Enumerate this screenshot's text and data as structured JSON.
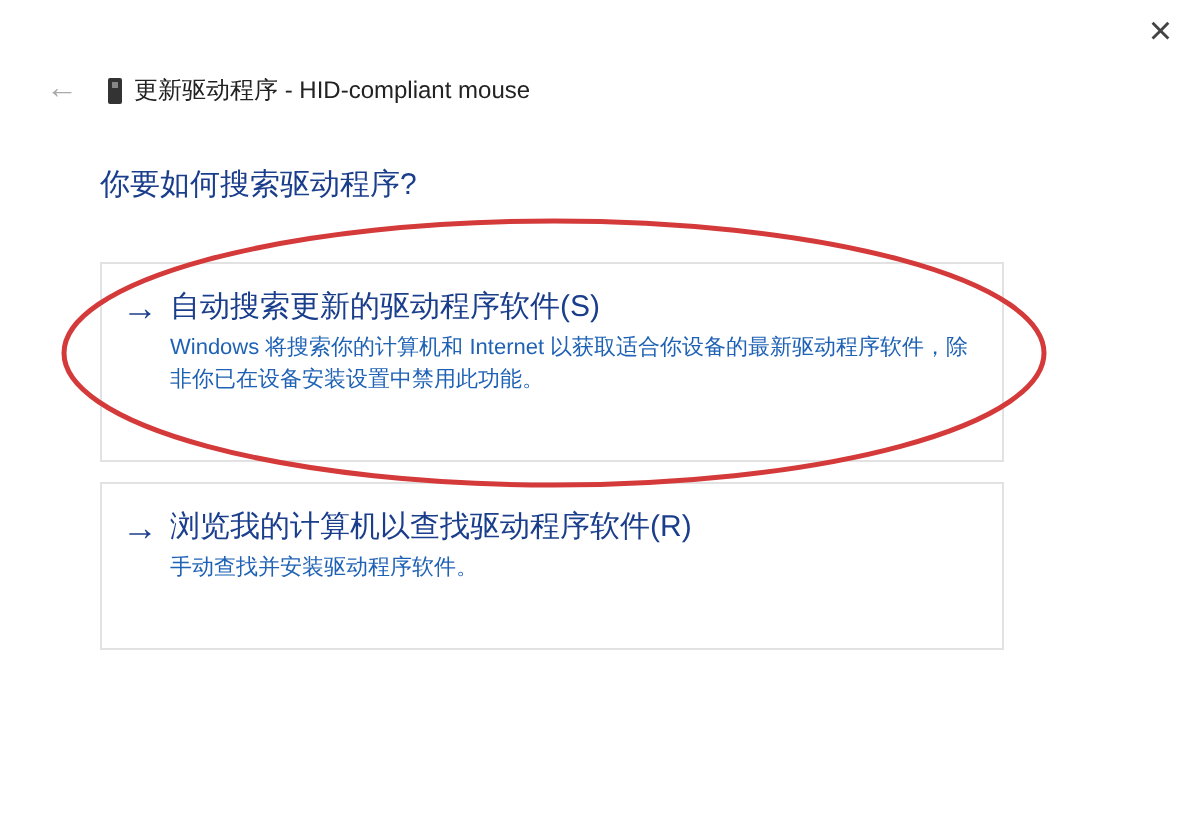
{
  "window": {
    "close": "×"
  },
  "header": {
    "back": "←",
    "title": "更新驱动程序 - HID-compliant mouse"
  },
  "question": "你要如何搜索驱动程序?",
  "options": [
    {
      "arrow": "→",
      "title": "自动搜索更新的驱动程序软件(S)",
      "description": "Windows 将搜索你的计算机和 Internet 以获取适合你设备的最新驱动程序软件，除非你已在设备安装设置中禁用此功能。",
      "highlighted": true
    },
    {
      "arrow": "→",
      "title": "浏览我的计算机以查找驱动程序软件(R)",
      "description": "手动查找并安装驱动程序软件。",
      "highlighted": false
    }
  ]
}
